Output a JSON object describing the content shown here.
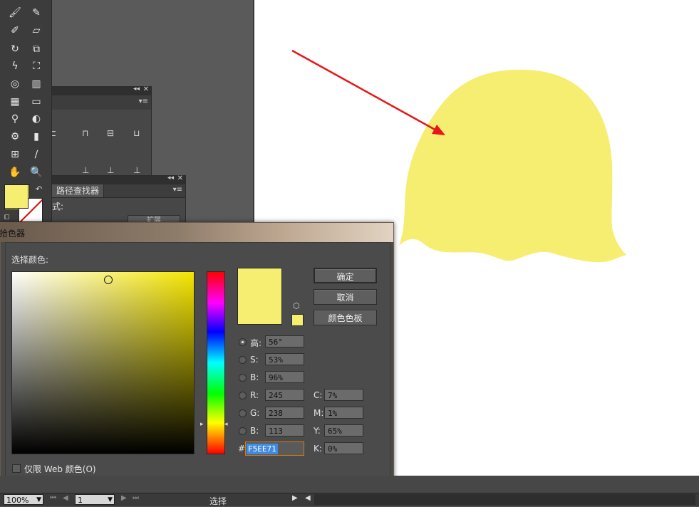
{
  "colors": {
    "selected_color": "#F5EE71",
    "artboard": "#ffffff",
    "arrow": "#e8161b"
  },
  "toolbar": {
    "tools": [
      "paintbrush-icon",
      "pencil-icon",
      "blob-brush-icon",
      "eraser-icon",
      "rotate-icon",
      "scale-icon",
      "warp-icon",
      "free-transform-icon",
      "symbol-sprayer-icon",
      "column-graph-icon",
      "mesh-icon",
      "gradient-icon",
      "eyedropper-icon",
      "blend-icon",
      "slice-icon",
      "chart-icon",
      "artboard-icon",
      "knife-icon",
      "hand-icon",
      "zoom-icon"
    ]
  },
  "pathfinder_panel": {
    "tab_label": "路径查找器",
    "mode_label": "式:",
    "expand_label": "扩展"
  },
  "color_picker": {
    "title": "拾色器",
    "select_color_label": "选择颜色:",
    "ok_label": "确定",
    "cancel_label": "取消",
    "swatches_label": "颜色色板",
    "fields": {
      "h_label": "高:",
      "h_value": "56°",
      "s_label": "S:",
      "s_value": "53%",
      "b_label": "B:",
      "b_value": "96%",
      "r_label": "R:",
      "r_value": "245",
      "g_label": "G:",
      "g_value": "238",
      "b2_label": "B:",
      "b2_value": "113",
      "c_label": "C:",
      "c_value": "7%",
      "m_label": "M:",
      "m_value": "1%",
      "y_label": "Y:",
      "y_value": "65%",
      "k_label": "K:",
      "k_value": "0%",
      "hex_label": "#",
      "hex_value": "F5EE71"
    },
    "web_only_label": "仅限 Web 颜色(O)"
  },
  "statusbar": {
    "zoom": "100%",
    "page": "1",
    "mode": "选择"
  }
}
